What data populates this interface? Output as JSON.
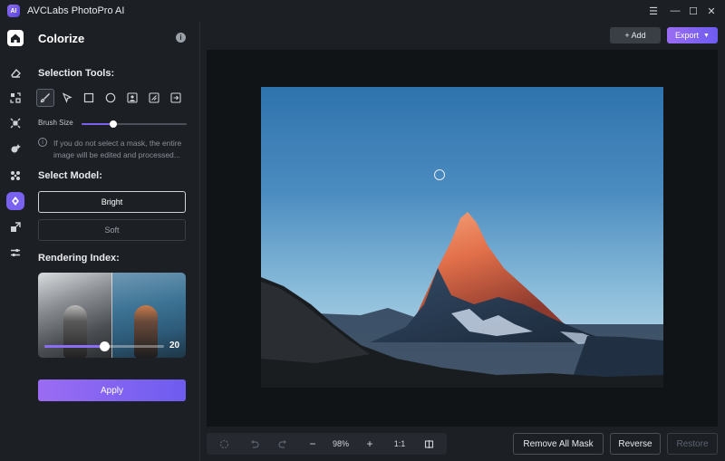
{
  "app": {
    "title": "AVCLabs PhotoPro AI",
    "logo_text": "AI"
  },
  "window_controls": [
    "menu-icon",
    "minimize-icon",
    "maximize-icon",
    "close-icon"
  ],
  "rail": [
    "home-icon",
    "eraser-icon",
    "replace-icon",
    "enhance-icon",
    "magic-icon",
    "blur-icon",
    "colorize-icon",
    "crop-icon",
    "adjust-icon"
  ],
  "panel": {
    "title": "Colorize",
    "selection_tools_label": "Selection Tools:",
    "tools": [
      "brush-icon",
      "pen-tool-icon",
      "rectangle-select-icon",
      "ellipse-select-icon",
      "person-select-icon",
      "object-select-icon",
      "import-mask-icon"
    ],
    "brush_size_label": "Brush Size",
    "brush_size_value": 0.3,
    "hint": "If you do not select a mask, the entire image will be edited and processed...",
    "select_model_label": "Select Model:",
    "models": [
      "Bright",
      "Soft"
    ],
    "selected_model": "Bright",
    "rendering_index_label": "Rendering Index:",
    "rendering_index_value": "20",
    "rendering_index_fraction": 0.5,
    "apply_label": "Apply"
  },
  "header": {
    "add_label": "+ Add",
    "export_label": "Export"
  },
  "bottom": {
    "zoom_label": "98%",
    "ratio_label": "1:1",
    "remove_all_mask_label": "Remove All Mask",
    "reverse_label": "Reverse",
    "restore_label": "Restore"
  },
  "colors": {
    "accent": "#7b61f0",
    "background": "#1c1f24",
    "canvas": "#111417"
  }
}
